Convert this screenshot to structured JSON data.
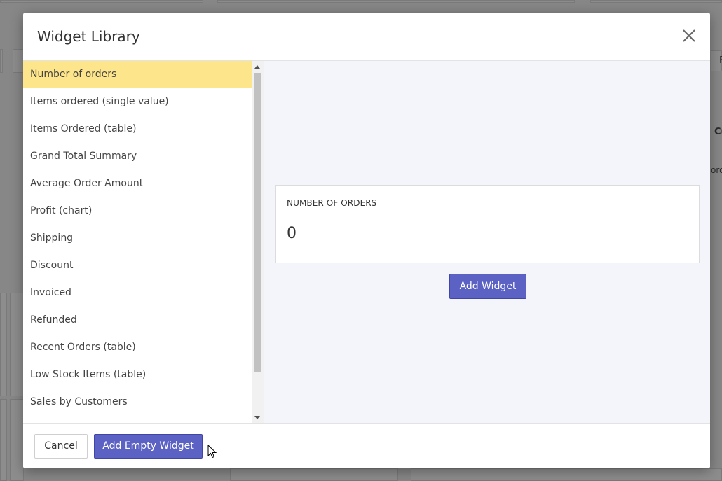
{
  "modal": {
    "title": "Widget Library"
  },
  "widget_list": {
    "items": [
      {
        "label": "Number of orders",
        "active": true
      },
      {
        "label": "Items ordered (single value)",
        "active": false
      },
      {
        "label": "Items Ordered (table)",
        "active": false
      },
      {
        "label": "Grand Total Summary",
        "active": false
      },
      {
        "label": "Average Order Amount",
        "active": false
      },
      {
        "label": "Profit (chart)",
        "active": false
      },
      {
        "label": "Shipping",
        "active": false
      },
      {
        "label": "Discount",
        "active": false
      },
      {
        "label": "Invoiced",
        "active": false
      },
      {
        "label": "Refunded",
        "active": false
      },
      {
        "label": "Recent Orders (table)",
        "active": false
      },
      {
        "label": "Low Stock Items (table)",
        "active": false
      },
      {
        "label": "Sales by Customers",
        "active": false
      }
    ]
  },
  "preview": {
    "widget_title": "NUMBER OF ORDERS",
    "widget_value": "0",
    "add_widget_label": "Add Widget"
  },
  "footer": {
    "cancel_label": "Cancel",
    "add_empty_label": "Add Empty Widget"
  },
  "background": {
    "fragment_1": "F",
    "fragment_2": "Cu",
    "fragment_3": "ord"
  },
  "colors": {
    "accent": "#5b62c3",
    "selected_item": "#fde58b",
    "preview_bg": "#f4f5fa"
  }
}
